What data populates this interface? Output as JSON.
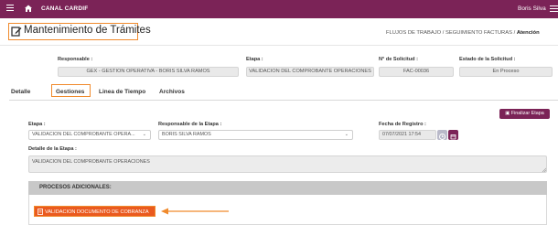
{
  "topbar": {
    "brand": "CANAL CARDIF",
    "user": "Boris Silva",
    "bg_color": "#7b2357"
  },
  "header": {
    "title": "Mantenimiento de Trámites",
    "breadcrumb_prefix": "FLUJOS DE TRABAJO / SEGUIMIENTO FACTURAS / ",
    "breadcrumb_current": "Atención"
  },
  "summary": {
    "responsable_label": "Responsable :",
    "responsable_value": "GEX - GESTION OPERATIVA - BORIS SILVA RAMOS",
    "etapa_label": "Etapa :",
    "etapa_value": "VALIDACION DEL COMPROBANTE OPERACIONES",
    "solicitud_label": "N° de Solicitud :",
    "solicitud_value": "FAC-00036",
    "estado_label": "Estado de la Solicitud :",
    "estado_value": "En Proceso"
  },
  "tabs": [
    {
      "label": "Detalle"
    },
    {
      "label": "Gestiones"
    },
    {
      "label": "Linea de Tiempo"
    },
    {
      "label": "Archivos"
    }
  ],
  "actions": {
    "finalizar_label": "Finalizar Etapa"
  },
  "form": {
    "etapa_label": "Etapa :",
    "etapa_value": "VALIDACION DEL COMPROBANTE OPERA...",
    "responsable_label": "Responsable de la Etapa :",
    "responsable_value": "BORIS SILVA RAMOS",
    "fecha_label": "Fecha de Registro :",
    "fecha_value": "07/07/2021 17:54",
    "detalle_label": "Detalle de la Etapa :",
    "detalle_value": "VALIDACION DEL COMPROBANTE OPERACIONES"
  },
  "procesos": {
    "header": "PROCESOS ADICIONALES:",
    "button_label": "VALIDACION DOCUMENTO DE COBRANZA",
    "button_color": "#ea5a1f",
    "highlight_color": "#f08a2c"
  }
}
